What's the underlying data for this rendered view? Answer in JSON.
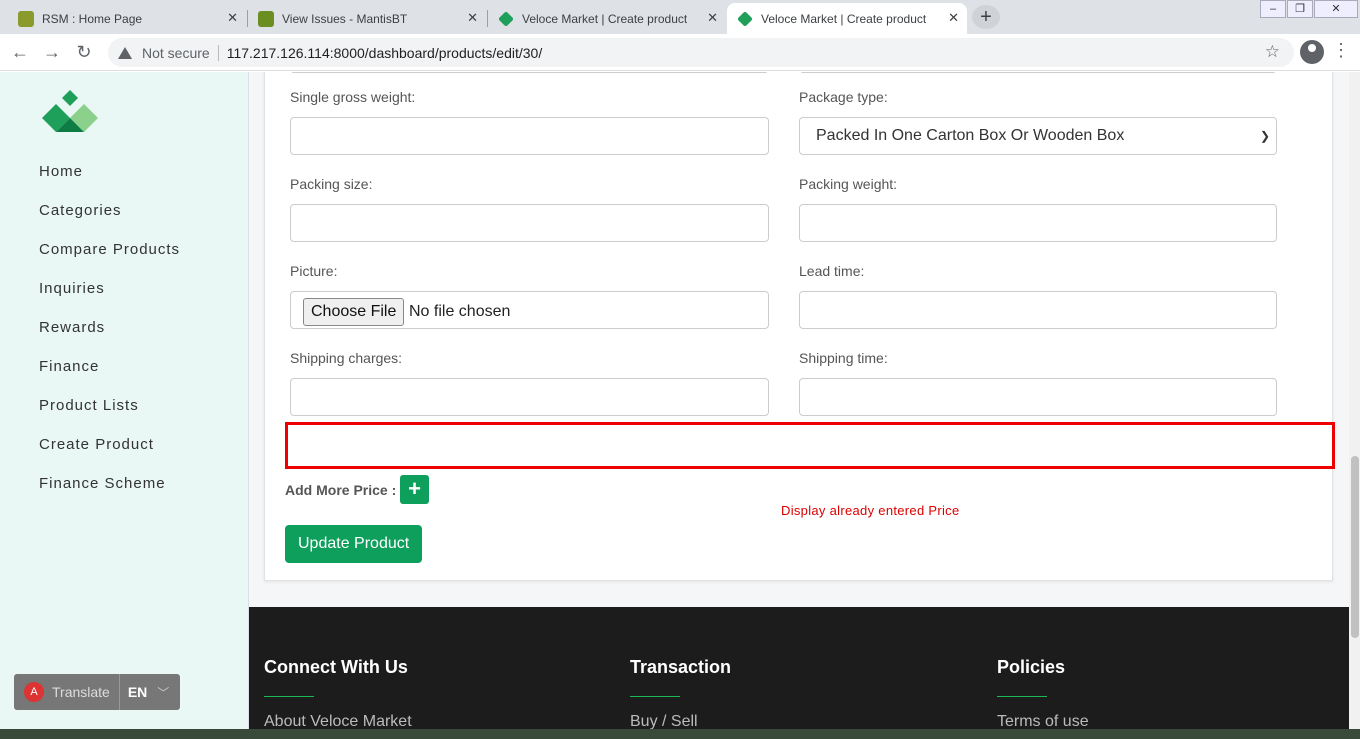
{
  "browser": {
    "tabs": [
      {
        "title": "RSM : Home Page",
        "active": false
      },
      {
        "title": "View Issues - MantisBT",
        "active": false
      },
      {
        "title": "Veloce Market | Create product",
        "active": false
      },
      {
        "title": "Veloce Market | Create product",
        "active": true
      }
    ],
    "security_label": "Not secure",
    "url": "117.217.126.114:8000/dashboard/products/edit/30/"
  },
  "sidebar": {
    "items": [
      {
        "label": "Home"
      },
      {
        "label": "Categories"
      },
      {
        "label": "Compare Products"
      },
      {
        "label": "Inquiries"
      },
      {
        "label": "Rewards"
      },
      {
        "label": "Finance"
      },
      {
        "label": "Product Lists"
      },
      {
        "label": "Create Product"
      },
      {
        "label": "Finance Scheme"
      }
    ],
    "translate": {
      "label": "Translate",
      "lang": "EN"
    }
  },
  "form": {
    "single_gross_weight": {
      "label": "Single gross weight:",
      "value": ""
    },
    "package_type": {
      "label": "Package type:",
      "value": "Packed In One Carton Box Or Wooden Box"
    },
    "packing_size": {
      "label": "Packing size:",
      "value": ""
    },
    "packing_weight": {
      "label": "Packing weight:",
      "value": ""
    },
    "picture": {
      "label": "Picture:",
      "button": "Choose File",
      "status": "No file chosen"
    },
    "lead_time": {
      "label": "Lead time:",
      "value": ""
    },
    "shipping_charges": {
      "label": "Shipping charges:",
      "value": ""
    },
    "shipping_time": {
      "label": "Shipping time:",
      "value": ""
    },
    "add_more_price_label": "Add More Price :",
    "add_more_price_button": "+",
    "annotation_note": "Display already entered Price",
    "update_button": "Update Product"
  },
  "footer": {
    "columns": [
      {
        "heading": "Connect With Us",
        "link": "About Veloce Market"
      },
      {
        "heading": "Transaction",
        "link": "Buy / Sell"
      },
      {
        "heading": "Policies",
        "link": "Terms of use"
      }
    ]
  },
  "colors": {
    "brand_green": "#0e9f5c",
    "annotation_red": "#e00000",
    "sidebar_bg": "#e9f8f5"
  }
}
